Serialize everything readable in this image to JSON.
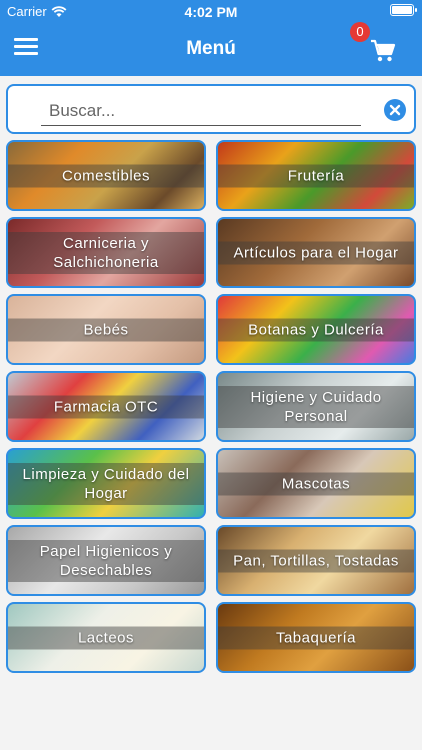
{
  "status_bar": {
    "carrier": "Carrier",
    "time": "4:02 PM"
  },
  "header": {
    "title": "Menú",
    "cart_count": "0"
  },
  "search": {
    "placeholder": "Buscar..."
  },
  "categories": [
    {
      "label": "Comestibles",
      "bg": "linear-gradient(135deg,#8a6a3a 0%,#e08a2a 30%,#c9a24a 55%,#6b4a2a 80%,#d9b060 100%)"
    },
    {
      "label": "Frutería",
      "bg": "linear-gradient(135deg,#c23a1a 0%,#e9a21a 30%,#4a9a2a 55%,#d24a3a 80%,#7aae2a 100%)"
    },
    {
      "label": "Carniceria y Salchichoneria",
      "bg": "linear-gradient(135deg,#7a2a2a 0%,#c25a5a 35%,#e3a6a0 60%,#9a3a3a 100%)"
    },
    {
      "label": "Artículos para el Hogar",
      "bg": "linear-gradient(135deg,#5a3a22 0%,#a06a3a 40%,#d0a070 70%,#7a4a2a 100%)"
    },
    {
      "label": "Bebés",
      "bg": "linear-gradient(135deg,#d9b39a 0%,#f2d7c3 40%,#e4c0a8 70%,#c49a80 100%)"
    },
    {
      "label": "Botanas y Dulcería",
      "bg": "linear-gradient(135deg,#e03a3a 0%,#f2c21a 30%,#3ab04a 55%,#e05ab0 80%,#4a7ae0 100%)"
    },
    {
      "label": "Farmacia OTC",
      "bg": "linear-gradient(135deg,#c0c8d0 0%,#e04040 30%,#f0d040 50%,#4060c0 75%,#d0d8e0 100%)"
    },
    {
      "label": "Higiene y Cuidado Personal",
      "bg": "linear-gradient(135deg,#7a8a8a 0%,#c8d0d0 40%,#e6ecec 70%,#9aa8a8 100%)"
    },
    {
      "label": "Limpieza y Cuidado del Hogar",
      "bg": "linear-gradient(135deg,#2aa0d0 0%,#5ac04a 35%,#f0d040 60%,#30b0b0 100%)"
    },
    {
      "label": "Mascotas",
      "bg": "linear-gradient(135deg,#c8c0b8 0%,#8a6a5a 35%,#d8c8b8 60%,#e0c84a 100%)"
    },
    {
      "label": "Papel Higienicos y Desechables",
      "bg": "linear-gradient(135deg,#a8a8a8 0%,#e8e8e8 40%,#c8c8c8 70%,#9a9a9a 100%)"
    },
    {
      "label": "Pan, Tortillas, Tostadas",
      "bg": "linear-gradient(135deg,#6a4a2a 0%,#d8b070 35%,#f0d8a0 60%,#a07040 100%)"
    },
    {
      "label": "Lacteos",
      "bg": "linear-gradient(135deg,#a0c8c0 0%,#eef0e8 40%,#f8f4e4 70%,#c8d8d0 100%)"
    },
    {
      "label": "Tabaquería",
      "bg": "linear-gradient(135deg,#6a3a10 0%,#c07a20 35%,#e0a040 60%,#8a5018 100%)"
    }
  ]
}
